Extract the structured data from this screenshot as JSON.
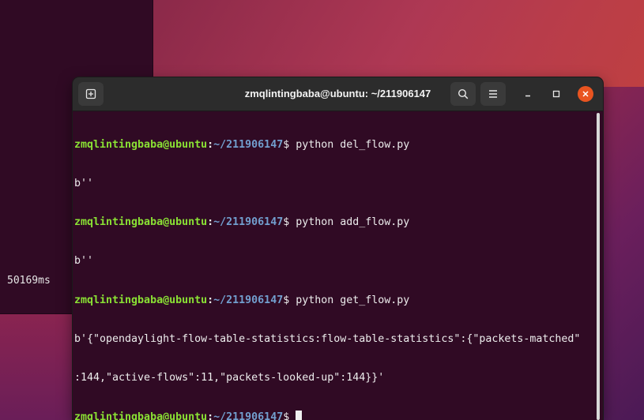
{
  "background_window": {
    "text": "50169ms"
  },
  "terminal": {
    "title": "zmqlintingbaba@ubuntu: ~/211906147",
    "icons": {
      "new_tab": "new-tab-icon",
      "search": "search-icon",
      "menu": "hamburger-menu-icon",
      "minimize": "minimize-icon",
      "maximize": "maximize-icon",
      "close": "close-icon"
    },
    "colors": {
      "background": "#300a24",
      "prompt_user": "#8ae234",
      "prompt_path": "#729fcf",
      "close_button": "#e95420"
    },
    "prompt": {
      "user": "zmqlintingbaba@ubuntu",
      "sep": ":",
      "path": "~/211906147",
      "symbol": "$ "
    },
    "lines": [
      {
        "type": "prompt",
        "command": "python del_flow.py"
      },
      {
        "type": "output",
        "text": "b''"
      },
      {
        "type": "prompt",
        "command": "python add_flow.py"
      },
      {
        "type": "output",
        "text": "b''"
      },
      {
        "type": "prompt",
        "command": "python get_flow.py"
      },
      {
        "type": "output",
        "text": "b'{\"opendaylight-flow-table-statistics:flow-table-statistics\":{\"packets-matched\""
      },
      {
        "type": "output",
        "text": ":144,\"active-flows\":11,\"packets-looked-up\":144}}'"
      },
      {
        "type": "prompt",
        "command": ""
      }
    ]
  }
}
